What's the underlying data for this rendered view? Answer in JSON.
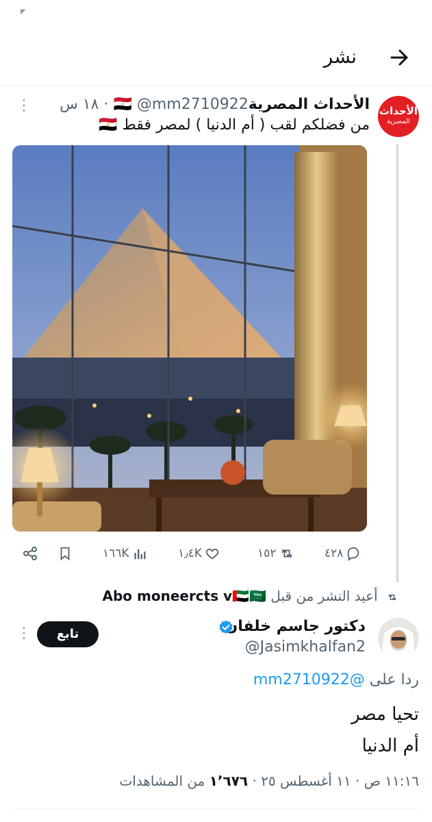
{
  "header": {
    "title": "نشر"
  },
  "parent": {
    "avatar_line1": "الأحداث",
    "avatar_line2": "المصرية",
    "name": "الأحداث المصرية🇪🇬",
    "handle": "@mm2710922",
    "time": "· ١٨ س",
    "text": "من فضلكم لقب ( أم الدنيا ) لمصر فقط 🇪🇬",
    "more": "⋮"
  },
  "actions": {
    "replies": "٤٢٨",
    "reposts": "١٥٢",
    "likes": "١٫٤K",
    "views": "١٦٦K"
  },
  "repost": {
    "prefix": "أعيد النشر من قبل",
    "user": "Abo moneercts v🇦🇪🇸🇦"
  },
  "tweet": {
    "name": "دكتور جاسم خلفان",
    "handle": "@Jasimkhalfan2",
    "follow": "تابع",
    "reply_prefix": "ردا على",
    "reply_handle": "@mm2710922",
    "line1": "تحيا مصر",
    "line2": "أم الدنيا",
    "meta_time": "١١:١٦ ص · ١١ أغسطس ٢٥ ·",
    "meta_views": "١٬٦٧٦",
    "meta_views_label": "من المشاهدات"
  },
  "colors": {
    "accent": "#1d9bf0",
    "brand_red": "#e31e24",
    "text": "#0f1419",
    "muted": "#536471"
  }
}
